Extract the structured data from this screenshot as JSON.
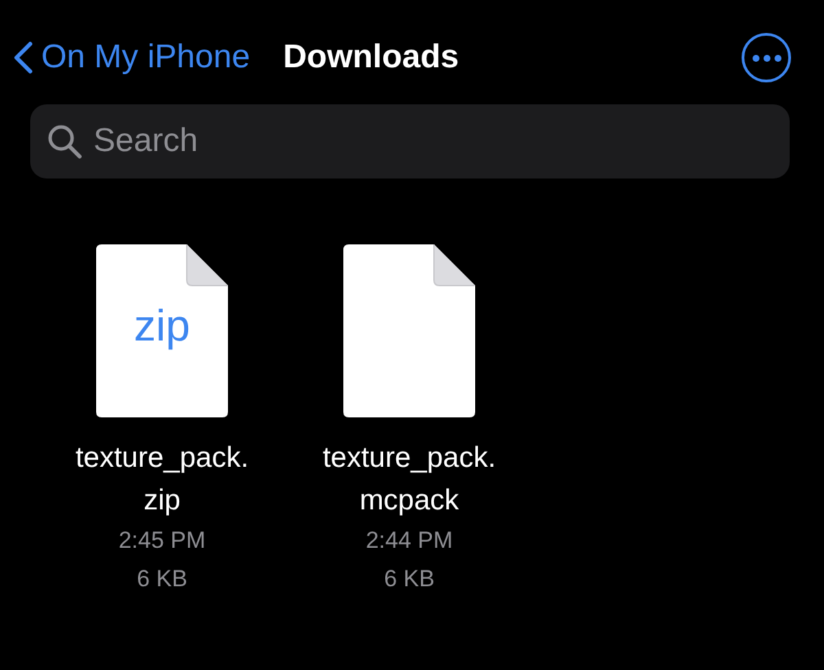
{
  "nav": {
    "back_label": "On My iPhone",
    "title": "Downloads"
  },
  "search": {
    "placeholder": "Search"
  },
  "files": [
    {
      "name_lines": [
        "texture_pack.",
        "zip"
      ],
      "badge": "zip",
      "time": "2:45 PM",
      "size": "6 KB"
    },
    {
      "name_lines": [
        "texture_pack.",
        "mcpack"
      ],
      "time": "2:44 PM",
      "size": "6 KB"
    }
  ]
}
